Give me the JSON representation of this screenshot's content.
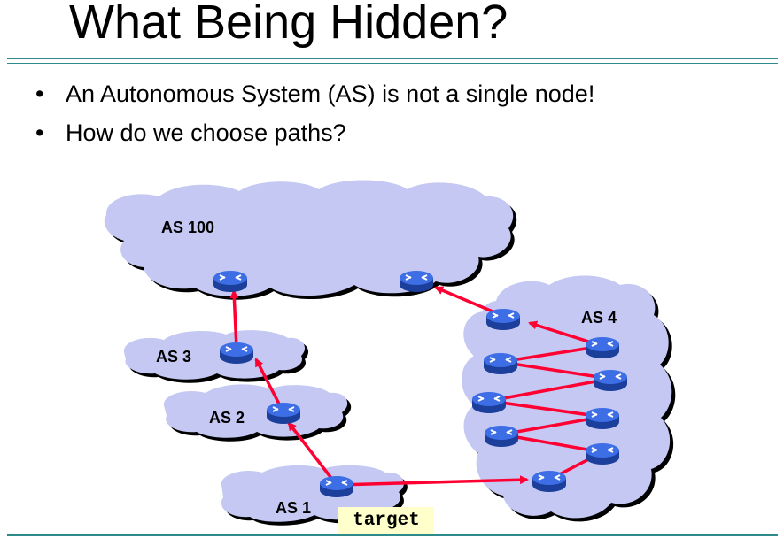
{
  "slide": {
    "title": "What Being Hidden?",
    "bullets": [
      "An Autonomous System (AS) is not a single node!",
      "How do we choose paths?"
    ]
  },
  "diagram": {
    "as_labels": {
      "as100": "AS 100",
      "as3": "AS 3",
      "as2": "AS 2",
      "as1": "AS 1",
      "as4": "AS 4"
    },
    "target_label": "target",
    "colors": {
      "cloud_fill": "#c4c8f2",
      "router_fill": "#2f5fd6",
      "link": "#ff0033",
      "rule": "#2e8b8b",
      "target_bg": "#ffffcc"
    }
  }
}
